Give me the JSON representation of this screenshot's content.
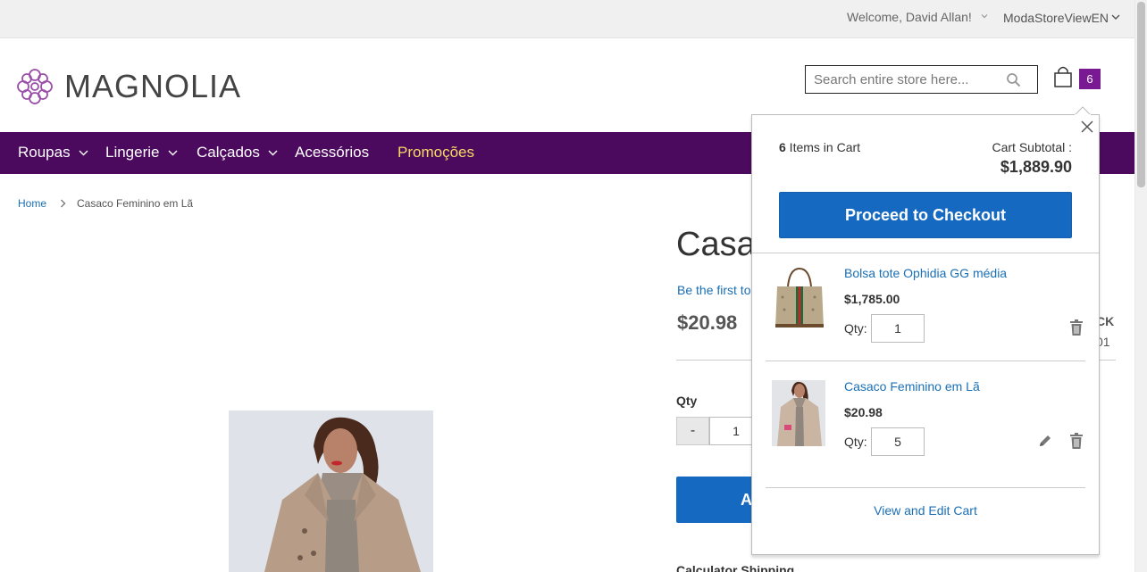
{
  "topbar": {
    "welcome": "Welcome, David Allan!",
    "store_switcher": "ModaStoreViewEN"
  },
  "header": {
    "logo_text": "MAGNOLIA",
    "search_placeholder": "Search entire store here...",
    "cart_count": "6"
  },
  "nav": {
    "items": [
      {
        "label": "Roupas",
        "has_dropdown": true
      },
      {
        "label": "Lingerie",
        "has_dropdown": true
      },
      {
        "label": "Calçados",
        "has_dropdown": true
      },
      {
        "label": "Acessórios",
        "has_dropdown": false
      },
      {
        "label": "Promoções",
        "has_dropdown": false
      }
    ],
    "promo_color": "#f5da63",
    "bar_color": "#4b0a5e"
  },
  "breadcrumb": {
    "home": "Home",
    "current": "Casaco Feminino em Lã"
  },
  "product": {
    "title_visible": "Casa",
    "review_link_visible": "Be the first to",
    "price": "$20.98",
    "stock_visible": "CK",
    "sku_visible": "01",
    "qty_label": "Qty",
    "qty_minus": "-",
    "qty_value": "1",
    "add_button_visible": "A",
    "calc_shipping": "Calculator Shipping"
  },
  "minicart": {
    "count": "6",
    "count_suffix": " Items in Cart",
    "subtotal_label": "Cart Subtotal :",
    "subtotal": "$1,889.90",
    "checkout_label": "Proceed to Checkout",
    "items": [
      {
        "name": "Bolsa tote Ophidia GG média",
        "price": "$1,785.00",
        "qty_label": "Qty:",
        "qty": "1"
      },
      {
        "name": "Casaco Feminino em Lã",
        "price": "$20.98",
        "qty_label": "Qty:",
        "qty": "5"
      }
    ],
    "view_cart_label": "View and Edit Cart"
  },
  "colors": {
    "accent_blue": "#1669c1",
    "link_blue": "#1a6fb5",
    "badge_purple": "#7a1a92"
  }
}
